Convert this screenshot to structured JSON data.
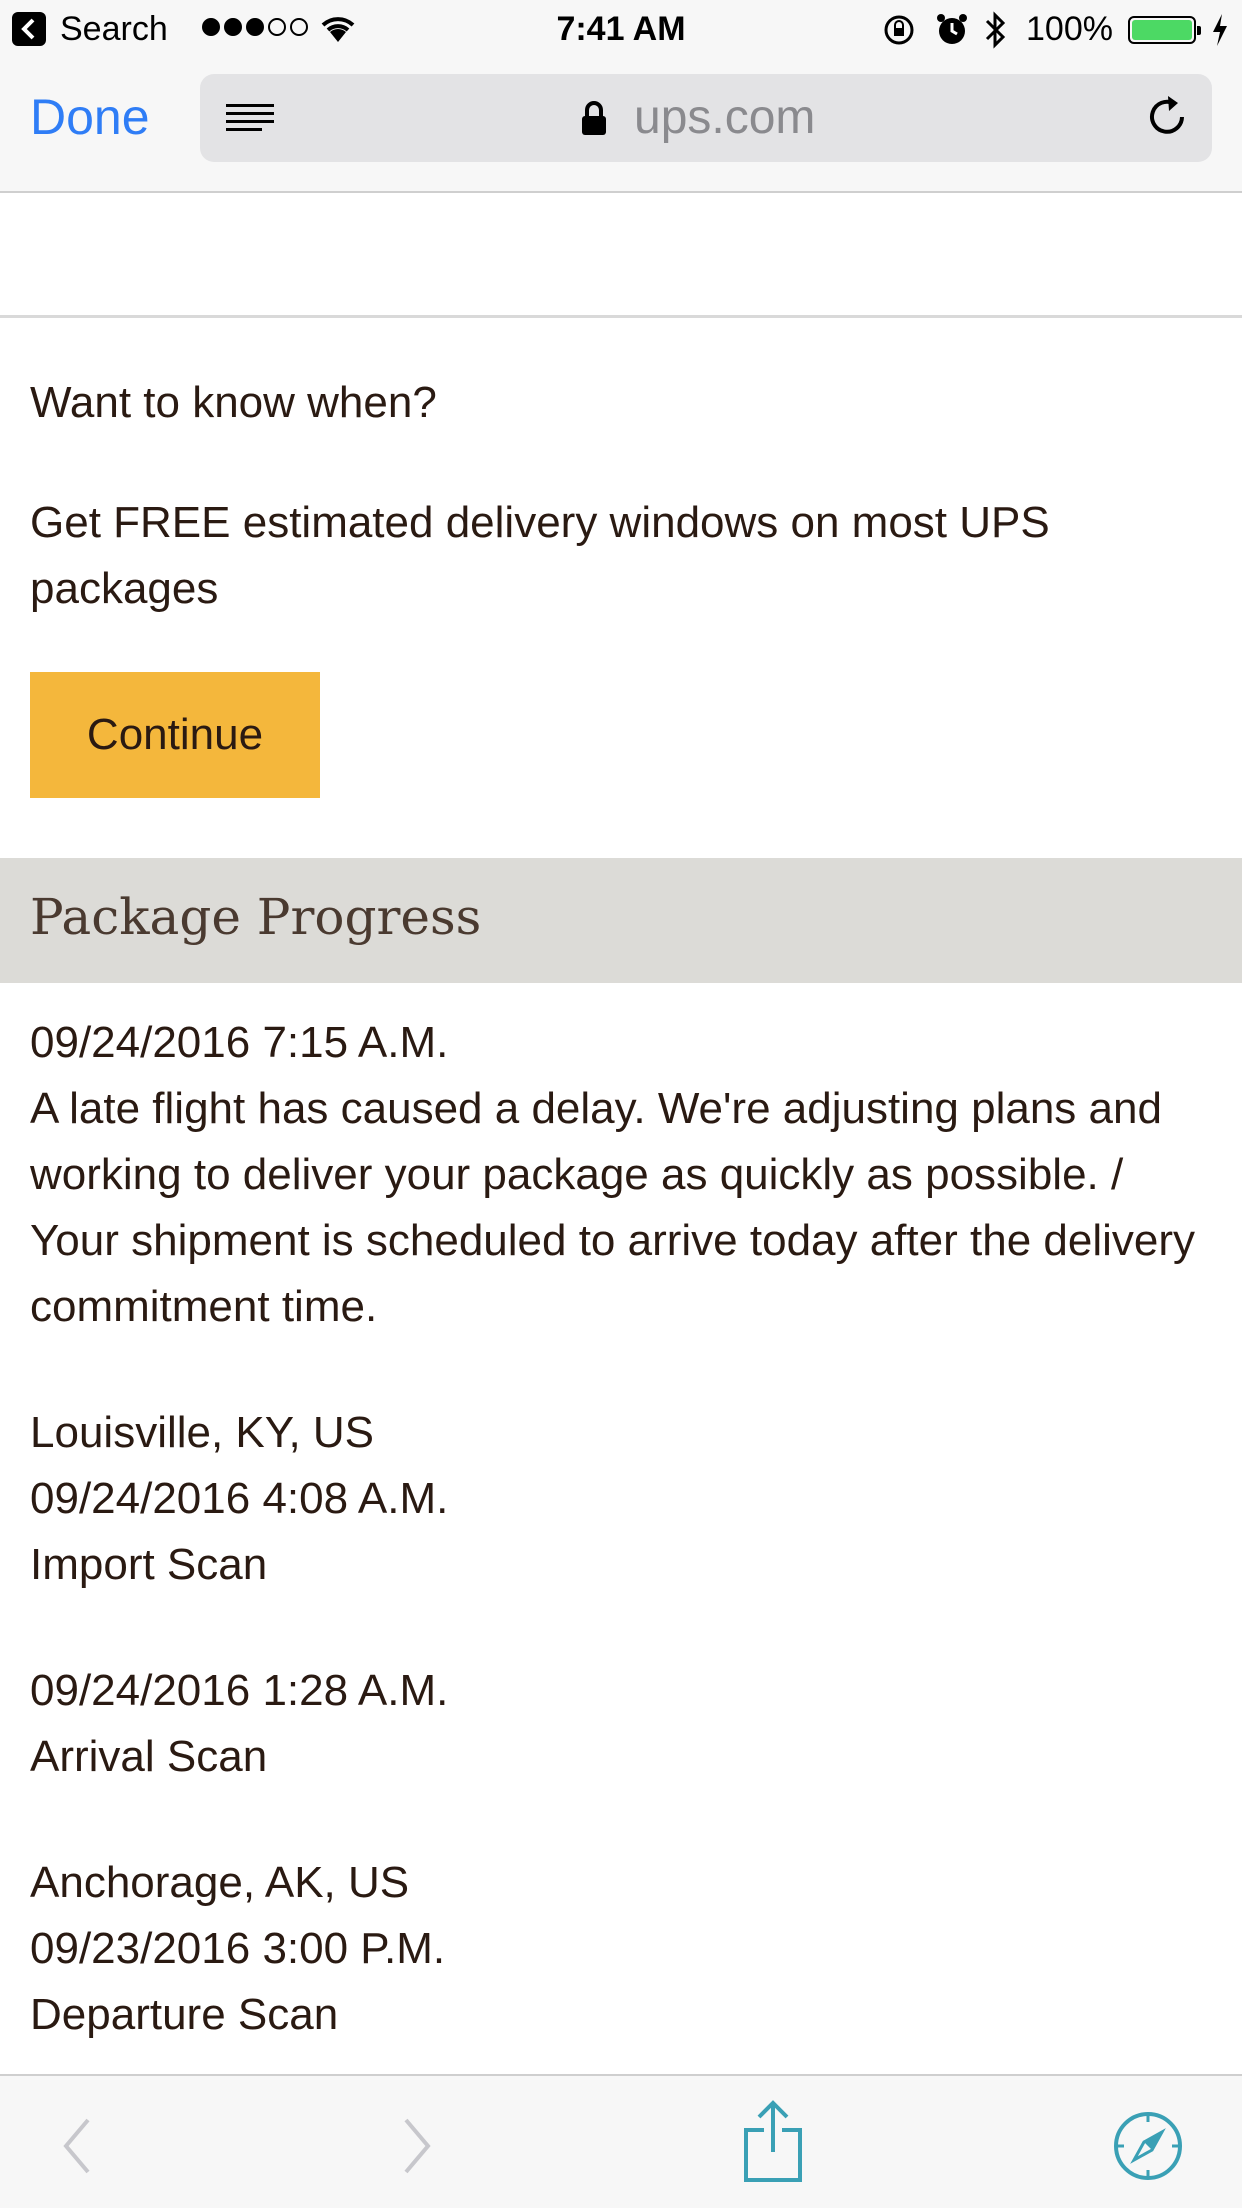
{
  "status_bar": {
    "back_label": "Search",
    "time": "7:41 AM",
    "battery": "100%",
    "signal_bars_filled": 3,
    "signal_bars_total": 5
  },
  "browser": {
    "done_label": "Done",
    "url": "ups.com"
  },
  "promo": {
    "heading": "Want to know when?",
    "text": "Get FREE estimated delivery windows on most UPS packages",
    "continue_label": "Continue"
  },
  "progress": {
    "title": "Package Progress",
    "events": [
      {
        "location": "",
        "datetime": "09/24/2016 7:15 A.M.",
        "description": "A late flight has caused a delay. We're adjusting plans and working to deliver your package as quickly as possible. / Your shipment is scheduled to arrive today after the delivery commitment time."
      },
      {
        "location": "Louisville, KY, US",
        "datetime": "09/24/2016 4:08 A.M.",
        "description": "Import Scan"
      },
      {
        "location": "",
        "datetime": "09/24/2016 1:28 A.M.",
        "description": "Arrival Scan"
      },
      {
        "location": "Anchorage, AK, US",
        "datetime": "09/23/2016 3:00 P.M.",
        "description": "Departure Scan"
      }
    ]
  },
  "colors": {
    "accent_blue": "#2f7df6",
    "continue_yellow": "#f4b73c",
    "section_header_gray": "#dcdbd7",
    "toolbar_teal": "#3aa0b5"
  }
}
